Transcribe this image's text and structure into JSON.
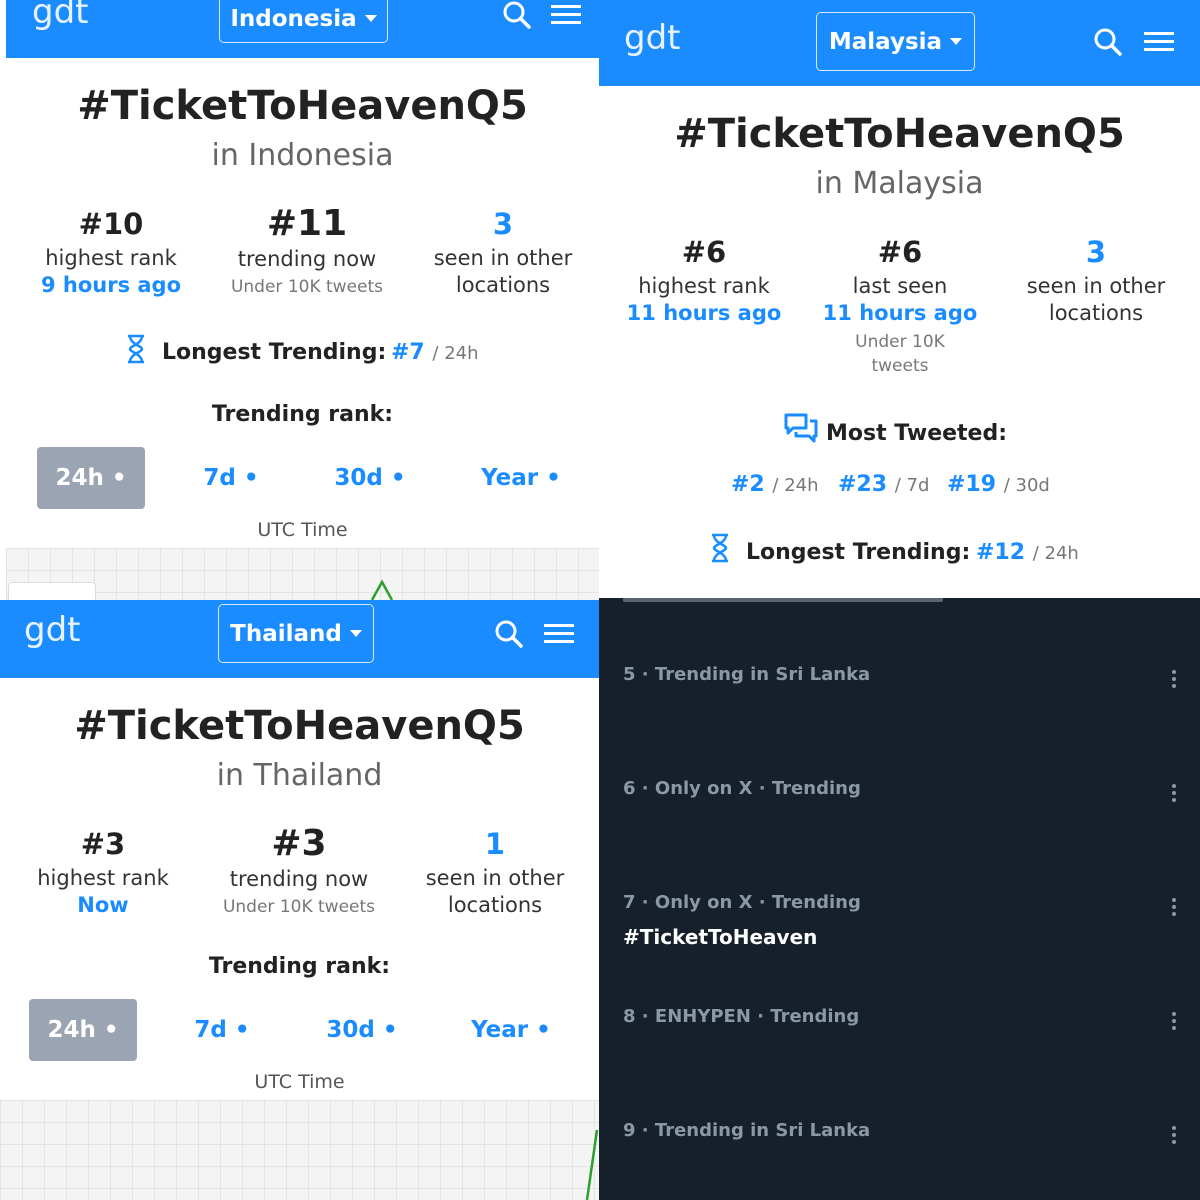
{
  "panels": [
    {
      "logo": "gdt",
      "country": "Indonesia",
      "hashtag": "#TicketToHeavenQ5",
      "location": "in Indonesia",
      "stats": [
        {
          "value": "#10",
          "label": "highest rank",
          "detail": "9 hours ago"
        },
        {
          "value": "#11",
          "label": "trending now",
          "detail": "Under 10K tweets"
        },
        {
          "value": "3",
          "label1": "seen in other",
          "label2": "locations"
        }
      ],
      "longest_trending_label": "Longest Trending:",
      "longest_trending_rank": "#7",
      "longest_trending_period": "/ 24h",
      "trending_rank_label": "Trending rank:",
      "tabs": [
        "24h •",
        "7d •",
        "30d •",
        "Year •"
      ],
      "active_tab": "24h •",
      "utc_label": "UTC Time"
    },
    {
      "logo": "gdt",
      "country": "Malaysia",
      "hashtag": "#TicketToHeavenQ5",
      "location": "in Malaysia",
      "stats": [
        {
          "value": "#6",
          "label": "highest rank",
          "detail": "11 hours ago"
        },
        {
          "value": "#6",
          "label": "last seen",
          "detail": "11 hours ago",
          "note1": "Under 10K",
          "note2": "tweets"
        },
        {
          "value": "3",
          "label1": "seen in other",
          "label2": "locations"
        }
      ],
      "most_tweeted_label": "Most Tweeted:",
      "most_tweeted": [
        {
          "rank": "#2",
          "period": "/ 24h"
        },
        {
          "rank": "#23",
          "period": "/ 7d"
        },
        {
          "rank": "#19",
          "period": "/ 30d"
        }
      ],
      "longest_trending_label": "Longest Trending:",
      "longest_trending_rank": "#12",
      "longest_trending_period": "/ 24h"
    },
    {
      "logo": "gdt",
      "country": "Thailand",
      "hashtag": "#TicketToHeavenQ5",
      "location": "in Thailand",
      "stats": [
        {
          "value": "#3",
          "label": "highest rank",
          "detail": "Now"
        },
        {
          "value": "#3",
          "label": "trending now",
          "detail": "Under 10K tweets"
        },
        {
          "value": "1",
          "label1": "seen in other",
          "label2": "locations"
        }
      ],
      "trending_rank_label": "Trending rank:",
      "tabs": [
        "24h •",
        "7d •",
        "30d •",
        "Year •"
      ],
      "active_tab": "24h •",
      "utc_label": "UTC Time"
    }
  ],
  "trends": [
    {
      "meta": "5 · Trending in Sri Lanka",
      "name": ""
    },
    {
      "meta": "6 · Only on X · Trending",
      "name": ""
    },
    {
      "meta": "7 · Only on X · Trending",
      "name": "#TicketToHeaven"
    },
    {
      "meta": "8 · ENHYPEN · Trending",
      "name": ""
    },
    {
      "meta": "9 · Trending in Sri Lanka",
      "name": ""
    }
  ],
  "colors": {
    "accent": "#1a8cff",
    "dark_bg": "#15202b",
    "active_tab": "#9aa4b2"
  },
  "icons": [
    "search-icon",
    "menu-icon",
    "hourglass-icon",
    "chat-bubbles-icon",
    "more-vertical-icon"
  ]
}
